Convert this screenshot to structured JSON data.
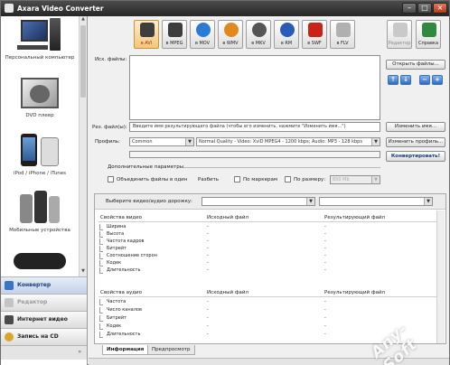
{
  "window": {
    "title": "Axara Video Converter"
  },
  "sidebar": {
    "devices": [
      {
        "label": "Персональный компьютер"
      },
      {
        "label": "DVD плеер"
      },
      {
        "label": "iPod / iPhone / iTunes"
      },
      {
        "label": "Мобильные устройства"
      }
    ],
    "nav": [
      {
        "label": "Конвертер",
        "state": "active"
      },
      {
        "label": "Редактор",
        "state": "disabled"
      },
      {
        "label": "Интернет видео",
        "state": "normal"
      },
      {
        "label": "Запись на CD",
        "state": "normal"
      }
    ],
    "footer_arrow": "»"
  },
  "toolbar": {
    "formats": [
      {
        "label": "в AVI",
        "selected": true,
        "icon": "film-icon",
        "color": "#3d3d3d"
      },
      {
        "label": "в MPEG",
        "selected": false,
        "icon": "film-icon",
        "color": "#3d3d3d"
      },
      {
        "label": "в MOV",
        "selected": false,
        "icon": "quicktime-icon",
        "color": "#2b7bd6"
      },
      {
        "label": "в WMV",
        "selected": false,
        "icon": "windows-media-icon",
        "color": "#e08a1e"
      },
      {
        "label": "в MKV",
        "selected": false,
        "icon": "matroska-icon",
        "color": "#555555"
      },
      {
        "label": "в RM",
        "selected": false,
        "icon": "realmedia-icon",
        "color": "#2a5bb8"
      },
      {
        "label": "в SWF",
        "selected": false,
        "icon": "flash-icon",
        "color": "#c8221a"
      },
      {
        "label": "в FLV",
        "selected": false,
        "icon": "flv-icon",
        "color": "#b0b0b0"
      }
    ],
    "editor_label": "Редактор",
    "help_label": "Справка"
  },
  "files": {
    "source_label": "Исх. файлы:",
    "open_files_button": "Открыть файлы...",
    "result_label": "Рез. файл(ы):",
    "result_placeholder": "Введите имя результирующего файла (чтобы его изменить, нажмите \"Изменить имя...\")",
    "rename_button": "Изменить имя...",
    "profile_label": "Профиль:",
    "profile_category": "Common",
    "profile_value": "Normal Quality - Video: XviD MPEG4 - 1200 kbps; Audio: MP3 - 128 kbps",
    "change_profile_button": "Изменить профиль...",
    "convert_button": "Конвертировать!",
    "extra_params_label": "Дополнительные параметры",
    "merge_label": "Объединить файлы в один",
    "split_label": "Разбить",
    "by_markers_label": "По маркерам",
    "by_size_label": "По размеру:",
    "size_value": "650 Mb"
  },
  "info": {
    "track_select_label": "Выберите видео/аудио дорожку:",
    "video_header": [
      "Свойства видео",
      "Исходный файл",
      "Результирующий файл"
    ],
    "video_rows": [
      {
        "name": "Ширина",
        "src": "-",
        "dst": "-"
      },
      {
        "name": "Высота",
        "src": "-",
        "dst": "-"
      },
      {
        "name": "Частота кадров",
        "src": "-",
        "dst": "-"
      },
      {
        "name": "Битрейт",
        "src": "-",
        "dst": "-"
      },
      {
        "name": "Соотношение сторон",
        "src": "-",
        "dst": "-"
      },
      {
        "name": "Кодек",
        "src": "-",
        "dst": "-"
      },
      {
        "name": "Длительность",
        "src": "-",
        "dst": "-"
      }
    ],
    "audio_header": [
      "Свойства аудио",
      "Исходный файл",
      "Результирующий файл"
    ],
    "audio_rows": [
      {
        "name": "Частота",
        "src": "-",
        "dst": "-"
      },
      {
        "name": "Число каналов",
        "src": "-",
        "dst": "-"
      },
      {
        "name": "Битрейт",
        "src": "-",
        "dst": "-"
      },
      {
        "name": "Кодек",
        "src": "-",
        "dst": "-"
      },
      {
        "name": "Длительность",
        "src": "-",
        "dst": "-"
      }
    ]
  },
  "tabs": [
    {
      "label": "Информация",
      "active": true
    },
    {
      "label": "Предпросмотр",
      "active": false
    }
  ],
  "watermark": "Any-Soft"
}
